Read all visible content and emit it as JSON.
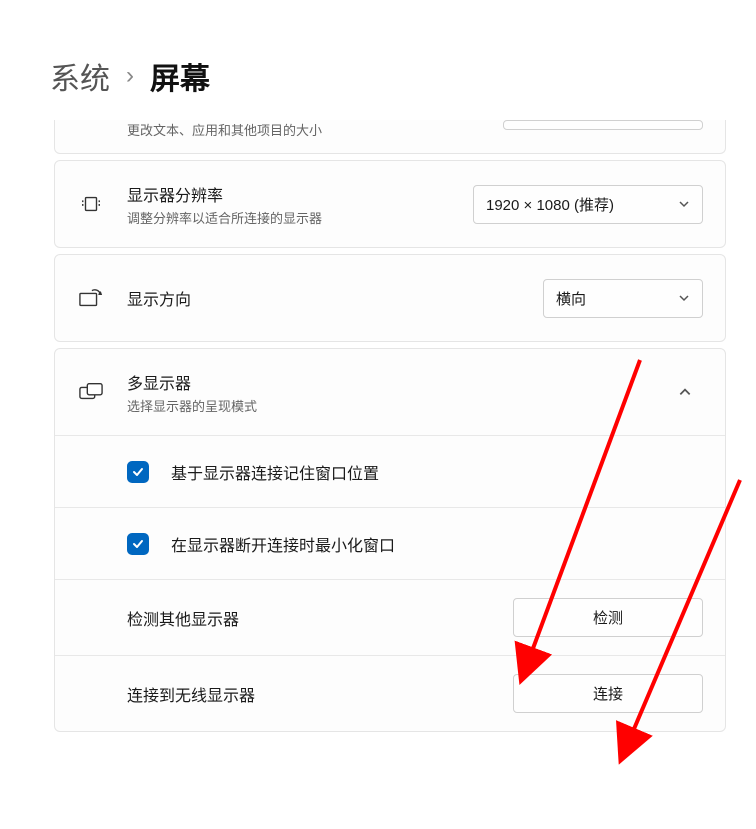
{
  "breadcrumb": {
    "parent": "系统",
    "separator": "›",
    "current": "屏幕"
  },
  "scale": {
    "subtitle": "更改文本、应用和其他项目的大小"
  },
  "resolution": {
    "title": "显示器分辨率",
    "subtitle": "调整分辨率以适合所连接的显示器",
    "value": "1920 × 1080 (推荐)"
  },
  "orientation": {
    "title": "显示方向",
    "value": "横向"
  },
  "multi": {
    "title": "多显示器",
    "subtitle": "选择显示器的呈现模式",
    "check1": "基于显示器连接记住窗口位置",
    "check2": "在显示器断开连接时最小化窗口",
    "detect_label": "检测其他显示器",
    "detect_btn": "检测",
    "wireless_label": "连接到无线显示器",
    "wireless_btn": "连接"
  }
}
